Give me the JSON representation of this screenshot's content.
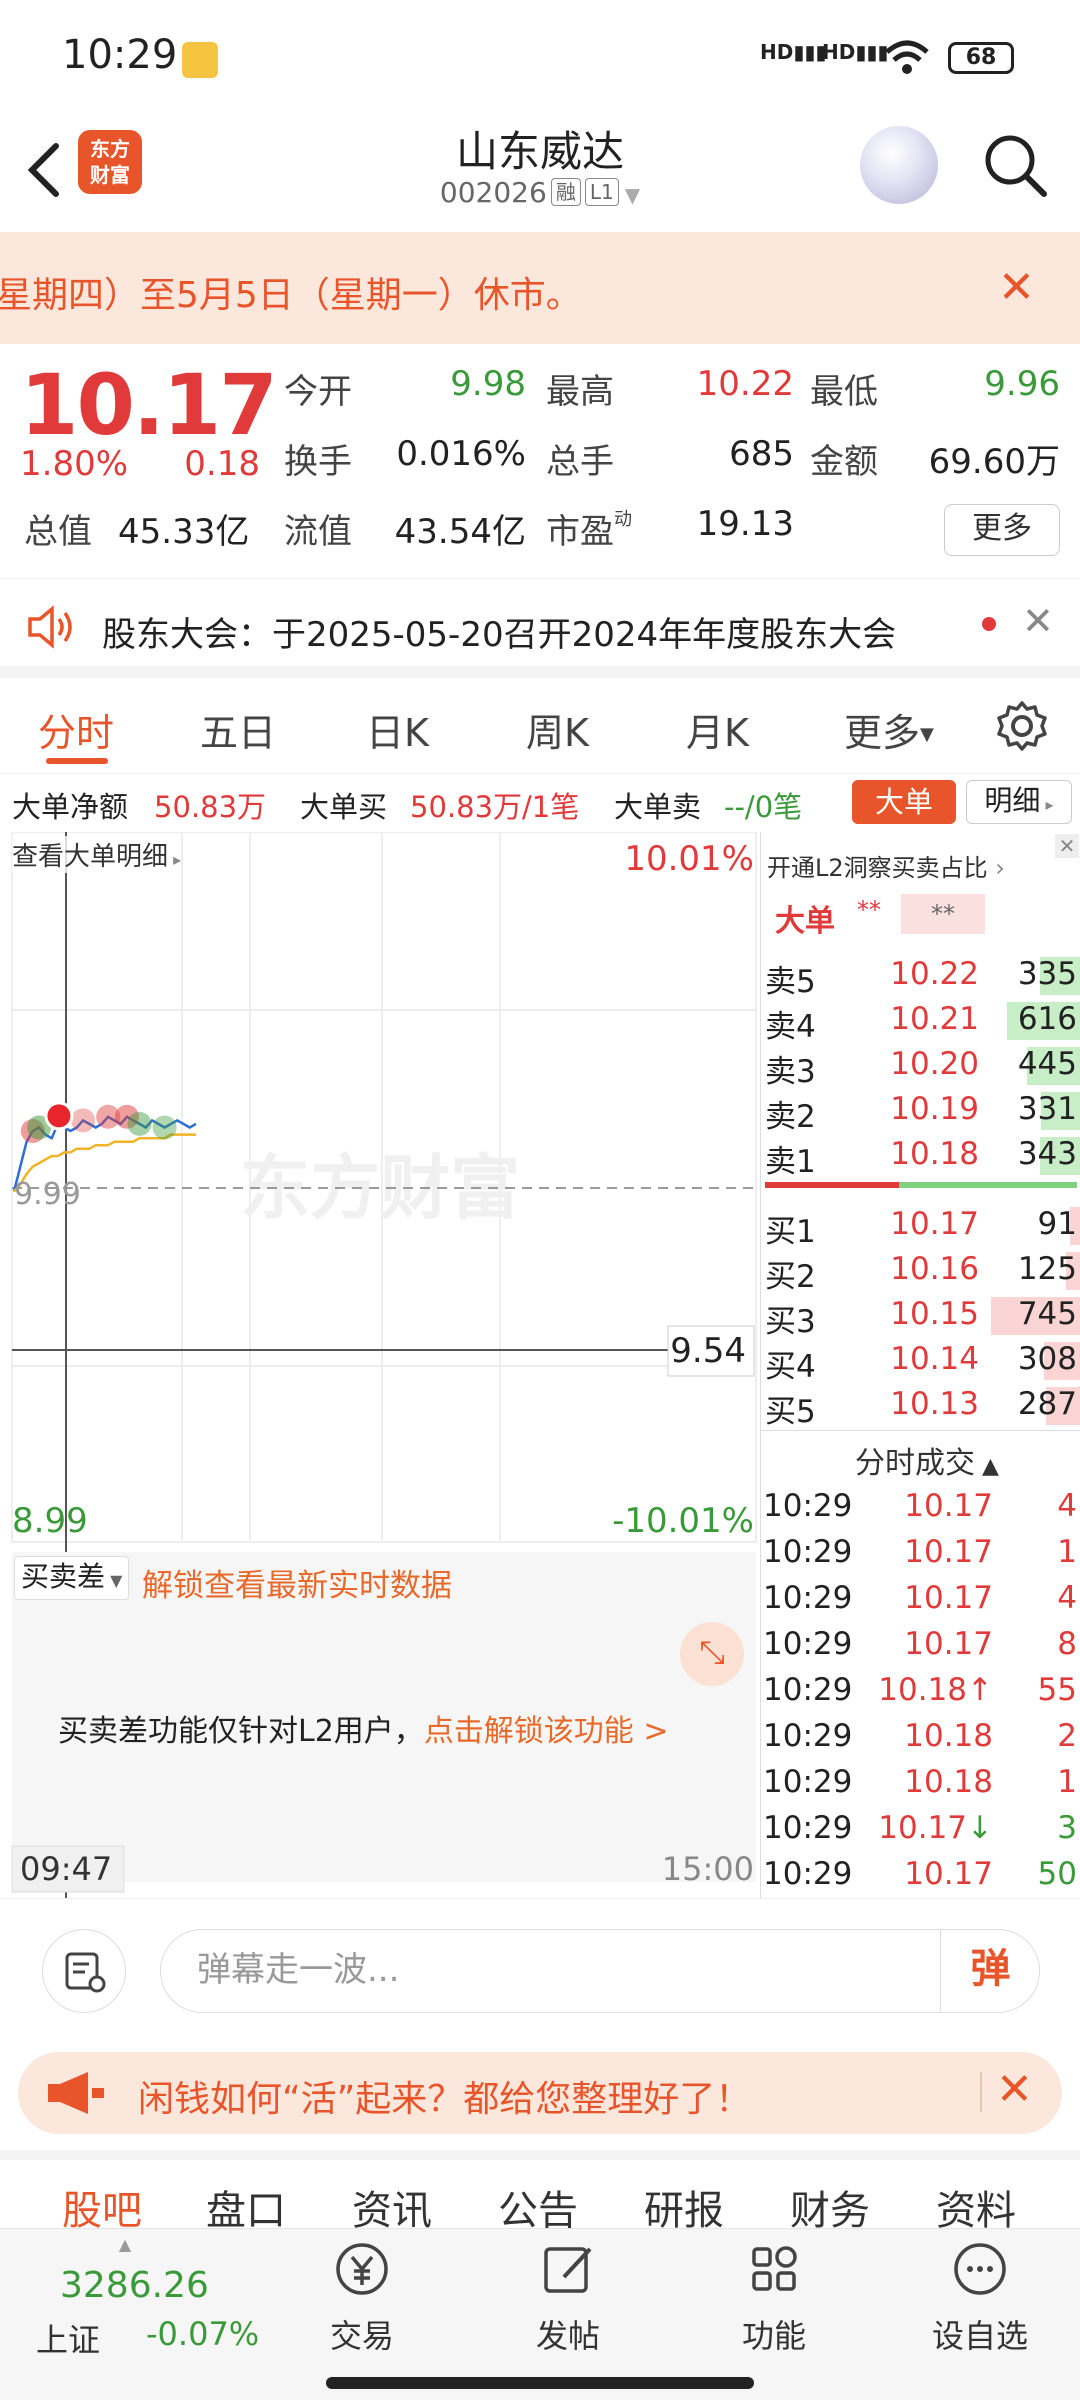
{
  "status_bar": {
    "time": "10:29",
    "signal_1": "HD",
    "signal_2": "HD",
    "battery": "68"
  },
  "header": {
    "logo_text_1": "东方",
    "logo_text_2": "财富",
    "title": "山东威达",
    "code": "002026",
    "tag_margin": "融",
    "tag_level": "L1"
  },
  "notice": {
    "text": "星期四）至5月5日（星期一）休市。"
  },
  "quote": {
    "price": "10.17",
    "change_pct": "1.80%",
    "change_abs": "0.18",
    "labels": {
      "open": "今开",
      "high": "最高",
      "low": "最低",
      "turnover": "换手",
      "volume": "总手",
      "amount": "金额",
      "mcap": "总值",
      "float_cap": "流值",
      "pe": "市盈",
      "pe_sup": "动"
    },
    "open": "9.98",
    "high": "10.22",
    "low": "9.96",
    "turnover": "0.016%",
    "volume": "685",
    "amount": "69.60万",
    "mcap": "45.33亿",
    "float_cap": "43.54亿",
    "pe": "19.13",
    "more_button": "更多"
  },
  "meeting": {
    "text": "股东大会：于2025-05-20召开2024年年度股东大会"
  },
  "tabs": [
    "分时",
    "五日",
    "日K",
    "周K",
    "月K",
    "更多"
  ],
  "bigorder": {
    "net_label": "大单净额",
    "net_value": "50.83万",
    "buy_label": "大单买",
    "buy_value": "50.83万/1笔",
    "sell_label": "大单卖",
    "sell_value": "--/0笔",
    "big_button": "大单",
    "detail_button": "明细"
  },
  "chart": {
    "detail_link": "查看大单明细",
    "top_pct": "10.01%",
    "bottom_pct": "-10.01%",
    "prev_close": "9.99",
    "crosshair_price": "9.54",
    "bottom_price": "8.99",
    "watermark": "东方财富",
    "start_time": "09:47",
    "end_time": "15:00",
    "diff_selector": "买卖差",
    "unlock_text": "解锁查看最新实时数据",
    "l2_note": "买卖差功能仅针对L2用户，",
    "l2_link": "点击解锁该功能 >"
  },
  "chart_data": {
    "type": "line",
    "x": [
      "09:30",
      "09:32",
      "09:34",
      "09:36",
      "09:38",
      "09:40",
      "09:42",
      "09:44",
      "09:46",
      "09:48",
      "09:50",
      "09:52",
      "09:54",
      "09:56",
      "09:58",
      "10:00",
      "10:02",
      "10:04",
      "10:06",
      "10:08",
      "10:10",
      "10:12",
      "10:14",
      "10:16",
      "10:18",
      "10:20",
      "10:22",
      "10:24",
      "10:26",
      "10:29"
    ],
    "series": [
      {
        "values": [
          9.98,
          10.05,
          10.12,
          10.15,
          10.16,
          10.14,
          10.13,
          10.17,
          10.16,
          10.15,
          10.16,
          10.18,
          10.17,
          10.16,
          10.17,
          10.19,
          10.18,
          10.17,
          10.19,
          10.18,
          10.17,
          10.16,
          10.18,
          10.17,
          10.16,
          10.17,
          10.18,
          10.17,
          10.16,
          10.17
        ]
      },
      {
        "values": [
          9.98,
          10.0,
          10.03,
          10.05,
          10.06,
          10.07,
          10.08,
          10.08,
          10.09,
          10.09,
          10.1,
          10.1,
          10.1,
          10.11,
          10.11,
          10.11,
          10.12,
          10.12,
          10.12,
          10.12,
          10.13,
          10.13,
          10.13,
          10.13,
          10.13,
          10.14,
          10.14,
          10.14,
          10.14,
          10.14
        ]
      }
    ],
    "ylim": [
      8.99,
      10.99
    ]
  },
  "orderbook": {
    "header_link": "开通L2洞察买卖占比",
    "big_label": "大单",
    "big_mask_1": "**",
    "big_mask_2": "**",
    "asks": [
      {
        "label": "卖5",
        "price": "10.22",
        "vol": "335",
        "ratio": 0.45
      },
      {
        "label": "卖4",
        "price": "10.21",
        "vol": "616",
        "ratio": 0.82
      },
      {
        "label": "卖3",
        "price": "10.20",
        "vol": "445",
        "ratio": 0.6
      },
      {
        "label": "卖2",
        "price": "10.19",
        "vol": "331",
        "ratio": 0.44
      },
      {
        "label": "卖1",
        "price": "10.18",
        "vol": "343",
        "ratio": 0.46
      }
    ],
    "bids": [
      {
        "label": "买1",
        "price": "10.17",
        "vol": "91",
        "ratio": 0.12
      },
      {
        "label": "买2",
        "price": "10.16",
        "vol": "125",
        "ratio": 0.17
      },
      {
        "label": "买3",
        "price": "10.15",
        "vol": "745",
        "ratio": 1.0
      },
      {
        "label": "买4",
        "price": "10.14",
        "vol": "308",
        "ratio": 0.41
      },
      {
        "label": "买5",
        "price": "10.13",
        "vol": "287",
        "ratio": 0.39
      }
    ],
    "ticks_title": "分时成交",
    "ticks": [
      {
        "time": "10:29",
        "price": "10.17",
        "vol": "4",
        "color": "red",
        "arrow": ""
      },
      {
        "time": "10:29",
        "price": "10.17",
        "vol": "1",
        "color": "red",
        "arrow": ""
      },
      {
        "time": "10:29",
        "price": "10.17",
        "vol": "4",
        "color": "red",
        "arrow": ""
      },
      {
        "time": "10:29",
        "price": "10.17",
        "vol": "8",
        "color": "red",
        "arrow": ""
      },
      {
        "time": "10:29",
        "price": "10.18",
        "vol": "55",
        "color": "red",
        "arrow": "↑"
      },
      {
        "time": "10:29",
        "price": "10.18",
        "vol": "2",
        "color": "red",
        "arrow": ""
      },
      {
        "time": "10:29",
        "price": "10.18",
        "vol": "1",
        "color": "red",
        "arrow": ""
      },
      {
        "time": "10:29",
        "price": "10.17",
        "vol": "3",
        "color": "green",
        "arrow": "↓"
      },
      {
        "time": "10:29",
        "price": "10.17",
        "vol": "50",
        "color": "green",
        "arrow": ""
      }
    ]
  },
  "danmu": {
    "placeholder": "弹幕走一波...",
    "button": "弹"
  },
  "promo": {
    "text": "闲钱如何“活”起来？都给您整理好了！"
  },
  "subtabs": [
    "股吧",
    "盘口",
    "资讯",
    "公告",
    "研报",
    "财务",
    "资料"
  ],
  "bottomnav": {
    "index_value": "3286.26",
    "index_name": "上证",
    "index_change": "-0.07%",
    "items": [
      "交易",
      "发帖",
      "功能",
      "设自选"
    ]
  },
  "colors": {
    "accent": "#e8552a",
    "up": "#e03a3a",
    "down": "#3a9a3a"
  }
}
